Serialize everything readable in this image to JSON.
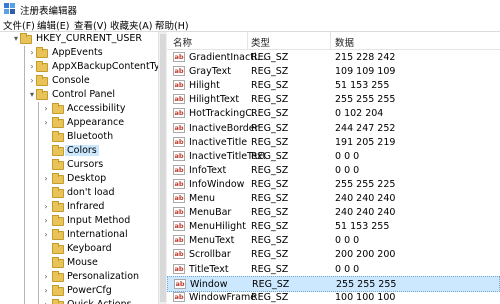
{
  "window": {
    "title": "注册表编辑器"
  },
  "menu": [
    "文件(F)",
    "编辑(E)",
    "查看(V)",
    "收藏夹(A)",
    "帮助(H)"
  ],
  "tree": {
    "root": "HKEY_CURRENT_USER",
    "items": [
      {
        "label": "AppEvents",
        "expandable": true
      },
      {
        "label": "AppXBackupContentType",
        "expandable": true
      },
      {
        "label": "Console",
        "expandable": true
      },
      {
        "label": "Control Panel",
        "expanded": true
      },
      {
        "label": "Accessibility",
        "expandable": true,
        "child": true
      },
      {
        "label": "Appearance",
        "expandable": true,
        "child": true
      },
      {
        "label": "Bluetooth",
        "expandable": false,
        "child": true
      },
      {
        "label": "Colors",
        "expandable": false,
        "child": true,
        "selected": true
      },
      {
        "label": "Cursors",
        "expandable": false,
        "child": true
      },
      {
        "label": "Desktop",
        "expandable": true,
        "child": true
      },
      {
        "label": "don't load",
        "expandable": false,
        "child": true
      },
      {
        "label": "Infrared",
        "expandable": true,
        "child": true
      },
      {
        "label": "Input Method",
        "expandable": true,
        "child": true
      },
      {
        "label": "International",
        "expandable": true,
        "child": true
      },
      {
        "label": "Keyboard",
        "expandable": false,
        "child": true
      },
      {
        "label": "Mouse",
        "expandable": false,
        "child": true
      },
      {
        "label": "Personalization",
        "expandable": true,
        "child": true
      },
      {
        "label": "PowerCfg",
        "expandable": true,
        "child": true
      },
      {
        "label": "Quick Actions",
        "expandable": true,
        "child": true
      }
    ]
  },
  "list": {
    "headers": {
      "name": "名称",
      "type": "类型",
      "data": "数据"
    },
    "rows": [
      {
        "name": "GradientInacti...",
        "type": "REG_SZ",
        "data": "215 228 242"
      },
      {
        "name": "GrayText",
        "type": "REG_SZ",
        "data": "109 109 109"
      },
      {
        "name": "Hilight",
        "type": "REG_SZ",
        "data": "51 153 255"
      },
      {
        "name": "HilightText",
        "type": "REG_SZ",
        "data": "255 255 255"
      },
      {
        "name": "HotTrackingC...",
        "type": "REG_SZ",
        "data": "0 102 204"
      },
      {
        "name": "InactiveBorder",
        "type": "REG_SZ",
        "data": "244 247 252"
      },
      {
        "name": "InactiveTitle",
        "type": "REG_SZ",
        "data": "191 205 219"
      },
      {
        "name": "InactiveTitleText",
        "type": "REG_SZ",
        "data": "0 0 0"
      },
      {
        "name": "InfoText",
        "type": "REG_SZ",
        "data": "0 0 0"
      },
      {
        "name": "InfoWindow",
        "type": "REG_SZ",
        "data": "255 255 225"
      },
      {
        "name": "Menu",
        "type": "REG_SZ",
        "data": "240 240 240"
      },
      {
        "name": "MenuBar",
        "type": "REG_SZ",
        "data": "240 240 240"
      },
      {
        "name": "MenuHilight",
        "type": "REG_SZ",
        "data": "51 153 255"
      },
      {
        "name": "MenuText",
        "type": "REG_SZ",
        "data": "0 0 0"
      },
      {
        "name": "Scrollbar",
        "type": "REG_SZ",
        "data": "200 200 200"
      },
      {
        "name": "TitleText",
        "type": "REG_SZ",
        "data": "0 0 0"
      },
      {
        "name": "Window",
        "type": "REG_SZ",
        "data": "255 255 255",
        "selected": true
      },
      {
        "name": "WindowFrame",
        "type": "REG_SZ",
        "data": "100 100 100"
      }
    ]
  }
}
